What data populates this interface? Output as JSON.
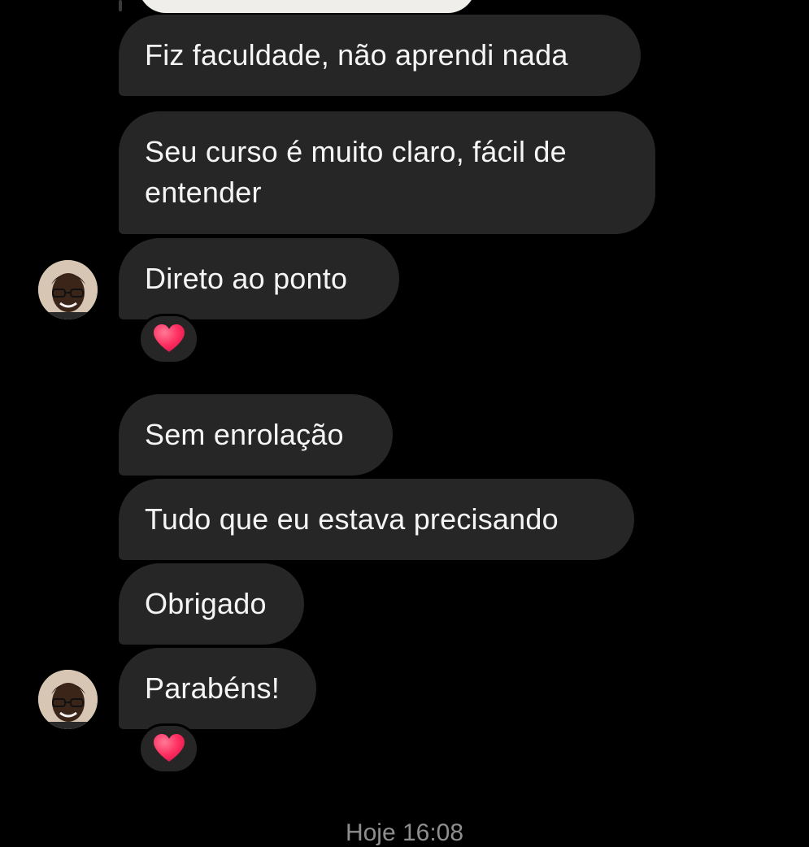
{
  "messages": [
    {
      "text": "Fiz faculdade, não aprendi nada"
    },
    {
      "text": "Seu curso é muito claro, fácil de entender"
    },
    {
      "text": "Direto ao ponto",
      "reaction": "heart-icon"
    },
    {
      "text": "Sem enrolação"
    },
    {
      "text": "Tudo que eu estava precisando"
    },
    {
      "text": "Obrigado"
    },
    {
      "text": "Parabéns!",
      "reaction": "heart-icon"
    }
  ],
  "footer": {
    "timestamp": "Hoje 16:08"
  },
  "colors": {
    "background": "#000000",
    "bubble": "#262626",
    "text": "#f5f5f5",
    "heart": "#ff3b6b",
    "timestamp": "#8e8e8e"
  }
}
